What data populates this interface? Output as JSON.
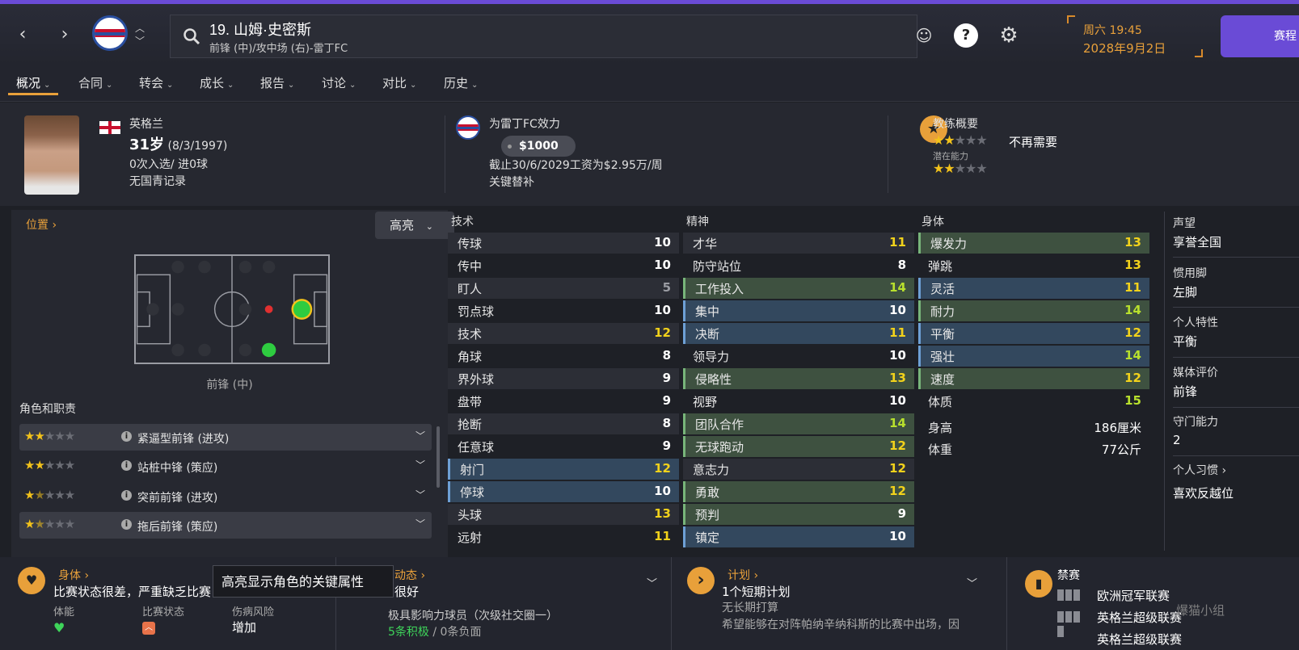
{
  "player": {
    "number_name": "19. 山姆·史密斯",
    "subtitle": "前锋 (中)/攻中场 (右)-雷丁FC"
  },
  "datetime": {
    "time": "周六 19:45",
    "date": "2028年9月2日"
  },
  "cta_label": "赛程",
  "tabs": [
    {
      "label": "概况"
    },
    {
      "label": "合同"
    },
    {
      "label": "转会"
    },
    {
      "label": "成长"
    },
    {
      "label": "报告"
    },
    {
      "label": "讨论"
    },
    {
      "label": "对比"
    },
    {
      "label": "历史"
    }
  ],
  "bio": {
    "nation": "英格兰",
    "age": "31岁",
    "dob": "(8/3/1997)",
    "caps": "0次入选/ 进0球",
    "youth": "无国青记录"
  },
  "club": {
    "playing_for": "为雷丁FC效力",
    "wage": "$1000",
    "contract": "截止30/6/2029工资为$2.95万/周",
    "status": "关键替补"
  },
  "coach": {
    "title": "教练概要",
    "current_stars": 2,
    "verdict": "不再需要",
    "potential_label": "潜在能力",
    "potential_stars": 2
  },
  "position_panel": {
    "title": "位置",
    "highlight_label": "高亮",
    "position_label": "前锋 (中)",
    "roles_title": "角色和职责",
    "roles": [
      {
        "stars": 2,
        "name": "紧逼型前锋 (进攻)"
      },
      {
        "stars": 2,
        "name": "站桩中锋 (策应)"
      },
      {
        "stars": 1.5,
        "name": "突前前锋 (进攻)"
      },
      {
        "stars": 1.5,
        "name": "拖后前锋 (策应)"
      }
    ]
  },
  "attributes": {
    "technical": {
      "title": "技术",
      "items": [
        {
          "name": "传球",
          "value": "10",
          "hl": ""
        },
        {
          "name": "传中",
          "value": "10",
          "hl": ""
        },
        {
          "name": "盯人",
          "value": "5",
          "hl": ""
        },
        {
          "name": "罚点球",
          "value": "10",
          "hl": ""
        },
        {
          "name": "技术",
          "value": "12",
          "hl": ""
        },
        {
          "name": "角球",
          "value": "8",
          "hl": ""
        },
        {
          "name": "界外球",
          "value": "9",
          "hl": ""
        },
        {
          "name": "盘带",
          "value": "9",
          "hl": ""
        },
        {
          "name": "抢断",
          "value": "8",
          "hl": ""
        },
        {
          "name": "任意球",
          "value": "9",
          "hl": ""
        },
        {
          "name": "射门",
          "value": "12",
          "hl": "blue"
        },
        {
          "name": "停球",
          "value": "10",
          "hl": "blue"
        },
        {
          "name": "头球",
          "value": "13",
          "hl": ""
        },
        {
          "name": "远射",
          "value": "11",
          "hl": ""
        }
      ]
    },
    "mental": {
      "title": "精神",
      "items": [
        {
          "name": "才华",
          "value": "11",
          "hl": ""
        },
        {
          "name": "防守站位",
          "value": "8",
          "hl": ""
        },
        {
          "name": "工作投入",
          "value": "14",
          "hl": "green"
        },
        {
          "name": "集中",
          "value": "10",
          "hl": "blue"
        },
        {
          "name": "决断",
          "value": "11",
          "hl": "blue"
        },
        {
          "name": "领导力",
          "value": "10",
          "hl": ""
        },
        {
          "name": "侵略性",
          "value": "13",
          "hl": "green"
        },
        {
          "name": "视野",
          "value": "10",
          "hl": ""
        },
        {
          "name": "团队合作",
          "value": "14",
          "hl": "green"
        },
        {
          "name": "无球跑动",
          "value": "12",
          "hl": "green"
        },
        {
          "name": "意志力",
          "value": "12",
          "hl": ""
        },
        {
          "name": "勇敢",
          "value": "12",
          "hl": "green"
        },
        {
          "name": "预判",
          "value": "9",
          "hl": "green"
        },
        {
          "name": "镇定",
          "value": "10",
          "hl": "blue"
        }
      ]
    },
    "physical": {
      "title": "身体",
      "items": [
        {
          "name": "爆发力",
          "value": "13",
          "hl": "green"
        },
        {
          "name": "弹跳",
          "value": "13",
          "hl": ""
        },
        {
          "name": "灵活",
          "value": "11",
          "hl": "blue"
        },
        {
          "name": "耐力",
          "value": "14",
          "hl": "green"
        },
        {
          "name": "平衡",
          "value": "12",
          "hl": "blue"
        },
        {
          "name": "强壮",
          "value": "14",
          "hl": "blue"
        },
        {
          "name": "速度",
          "value": "12",
          "hl": "green"
        },
        {
          "name": "体质",
          "value": "15",
          "hl": ""
        }
      ],
      "height_label": "身高",
      "height_value": "186厘米",
      "weight_label": "体重",
      "weight_value": "77公斤"
    }
  },
  "side_info": {
    "reputation_label": "声望",
    "reputation": "享誉全国",
    "foot_label": "惯用脚",
    "foot": "左脚",
    "trait_label": "个人特性",
    "trait": "平衡",
    "media_label": "媒体评价",
    "media": "前锋",
    "gk_label": "守门能力",
    "gk": "2",
    "habits_label": "个人习惯",
    "habit": "喜欢反越位"
  },
  "bottom": {
    "body_title": "身体",
    "body_text": "比赛状态很差，严重缺乏比赛",
    "fitness_label": "体能",
    "match_label": "比赛状态",
    "injury_label": "伤病风险",
    "injury_value": "增加",
    "tooltip": "高亮显示角色的关键属性",
    "dyn_title": "动态",
    "dyn_value": "很好",
    "dyn_sub": "极具影响力球员（次级社交圈一）",
    "dyn_pos": "5条积极",
    "dyn_sep": " / ",
    "dyn_neg": "0条负面",
    "plan_title": "计划",
    "plan_value": "1个短期计划",
    "plan_sub": "无长期打算",
    "plan_desc": "希望能够在对阵帕纳辛纳科斯的比赛中出场，因",
    "ban_title": "禁赛",
    "ban1": "欧洲冠军联赛",
    "ban2": "英格兰超级联赛",
    "ban3": "英格兰超级联赛"
  },
  "watermark": "爆猫小组",
  "colors": {
    "accent": "#e8a03a",
    "brand": "#6a4bd6",
    "blue_hl": "#33485e",
    "green_hl": "#3e5140"
  }
}
